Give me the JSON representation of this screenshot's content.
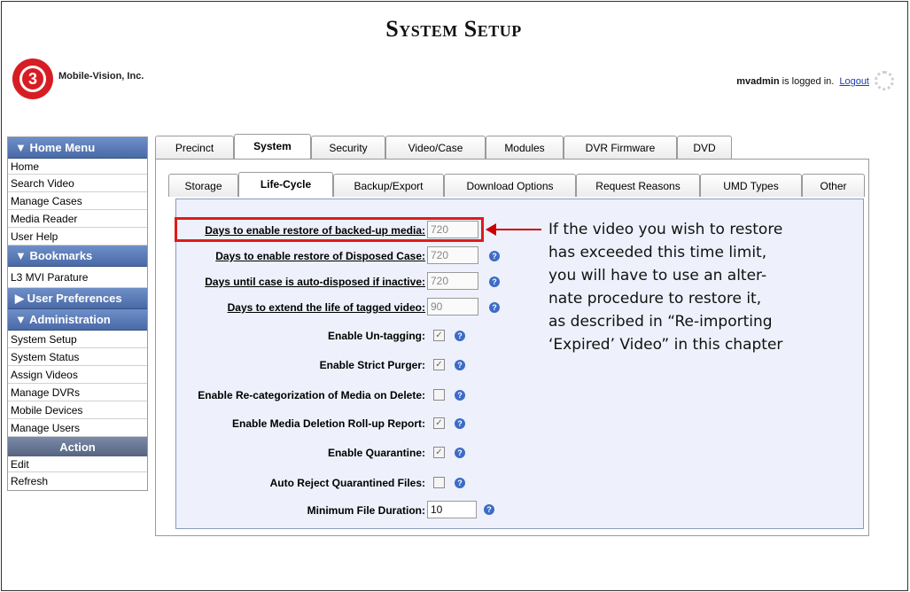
{
  "header": {
    "title": "System Setup",
    "company": "Mobile-Vision, Inc.",
    "user": "mvadmin",
    "logged_text": " is logged in.",
    "logout": "Logout",
    "logo_text": "3"
  },
  "sidebar": {
    "home_menu": "▼  Home Menu",
    "home_items": [
      "Home",
      "Search Video",
      "Manage Cases",
      "Media Reader",
      "User Help"
    ],
    "bookmarks": "▼  Bookmarks",
    "bookmark_items": [
      "L3 MVI Parature"
    ],
    "user_prefs": "▶  User Preferences",
    "administration": "▼  Administration",
    "admin_items": [
      "System Setup",
      "System Status",
      "Assign Videos",
      "Manage DVRs",
      "Mobile Devices",
      "Manage Users"
    ],
    "action": "Action",
    "action_items": [
      "Edit",
      "Refresh"
    ]
  },
  "tabs_top": [
    "Precinct",
    "System",
    "Security",
    "Video/Case",
    "Modules",
    "DVR Firmware",
    "DVD"
  ],
  "tabs_sub": [
    "Storage",
    "Life-Cycle",
    "Backup/Export",
    "Download Options",
    "Request Reasons",
    "UMD Types",
    "Other"
  ],
  "form": {
    "days_backed_up_label": "Days to enable restore of backed-up media:",
    "days_backed_up": "720",
    "days_disposed_label": "Days to enable restore of Disposed Case:",
    "days_disposed": "720",
    "days_auto_dispose_label": "Days until case is auto-disposed if inactive:",
    "days_auto_dispose": "720",
    "days_tagged_label": "Days to extend the life of tagged video:",
    "days_tagged": "90",
    "untag_label": "Enable Un-tagging:",
    "strict_label": "Enable Strict Purger:",
    "recat_label": "Enable Re-categorization of Media on Delete:",
    "rollup_label": "Enable Media Deletion Roll-up Report:",
    "quarantine_label": "Enable Quarantine:",
    "autoreject_label": "Auto Reject Quarantined Files:",
    "min_duration_label": "Minimum File Duration:",
    "min_duration": "10"
  },
  "note": {
    "lines": [
      "If the video you wish to restore",
      "has exceeded this time limit,",
      "you will have to use an alter-",
      "nate procedure to restore it,",
      "as described in “Re-importing",
      "‘Expired’ Video” in this chapter"
    ]
  }
}
